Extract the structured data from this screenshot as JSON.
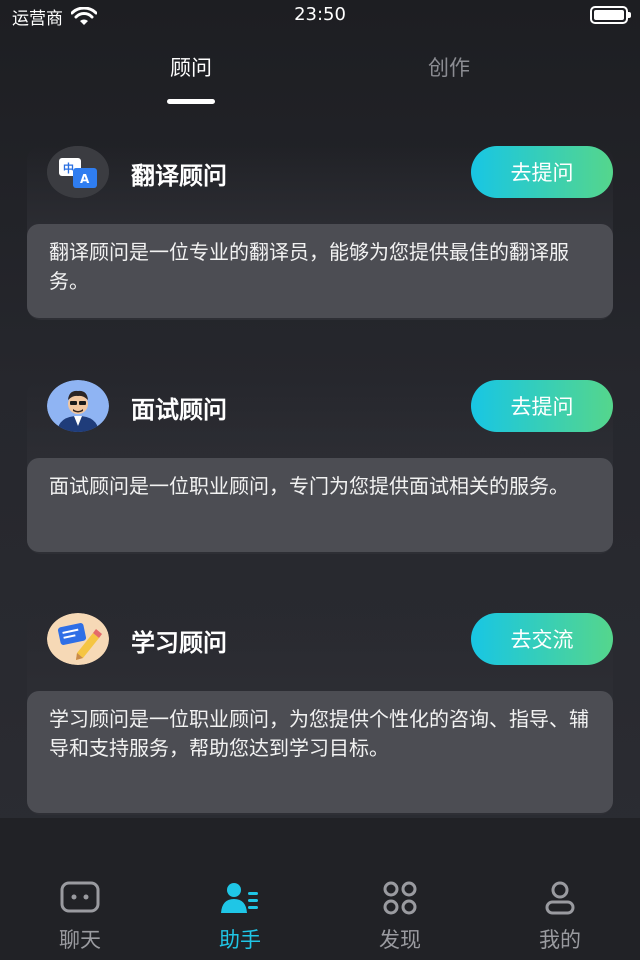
{
  "status_bar": {
    "carrier": "运营商",
    "time": "23:50",
    "battery_level": 1.0
  },
  "top_tabs": [
    {
      "label": "顾问",
      "active": true
    },
    {
      "label": "创作",
      "active": false
    }
  ],
  "advisors": [
    {
      "title": "翻译顾问",
      "button": "去提问",
      "description": "翻译顾问是一位专业的翻译员，能够为您提供最佳的翻译服务。",
      "avatar_icon": "translate-icon"
    },
    {
      "title": "面试顾问",
      "button": "去提问",
      "description": "面试顾问是一位职业顾问，专门为您提供面试相关的服务。",
      "avatar_icon": "interviewer-avatar-icon"
    },
    {
      "title": "学习顾问",
      "button": "去交流",
      "description": "学习顾问是一位职业顾问，为您提供个性化的咨询、指导、辅导和支持服务，帮助您达到学习目标。",
      "avatar_icon": "study-notes-icon"
    }
  ],
  "bottom_nav": [
    {
      "label": "聊天",
      "icon": "chat-icon",
      "active": false
    },
    {
      "label": "助手",
      "icon": "assistant-icon",
      "active": true
    },
    {
      "label": "发现",
      "icon": "discover-icon",
      "active": false
    },
    {
      "label": "我的",
      "icon": "profile-icon",
      "active": false
    }
  ],
  "colors": {
    "accent": "#1fc6e6",
    "button_gradient_start": "#18c6e4",
    "button_gradient_end": "#55d68c",
    "background": "#26272d",
    "card": "#4c4d53"
  }
}
